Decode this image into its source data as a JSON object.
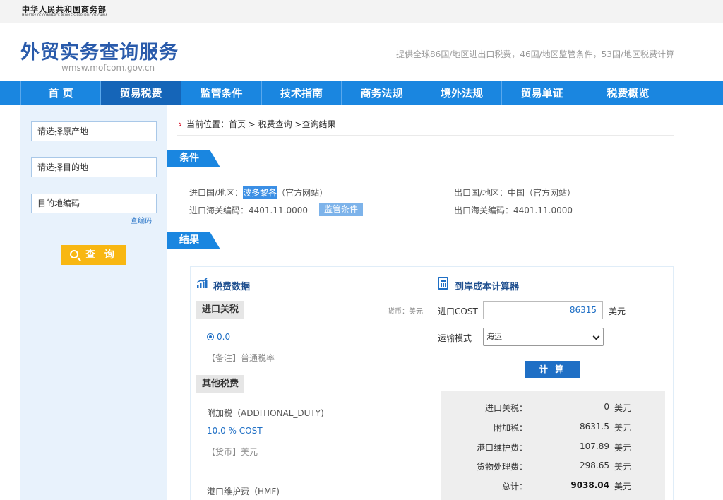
{
  "header": {
    "ministry_cn": "中华人民共和国商务部",
    "ministry_en": "MINISTRY OF COMMERCE PEOPLE'S REPUBLIC OF CHINA",
    "site_title": "外贸实务查询服务",
    "site_url": "wmsw.mofcom.gov.cn",
    "slogan": "提供全球86国/地区进出口税费，46国/地区监管条件，53国/地区税费计算"
  },
  "nav": [
    "首 页",
    "贸易税费",
    "监管条件",
    "技术指南",
    "商务法规",
    "境外法规",
    "贸易单证",
    "税费概览"
  ],
  "sidebar": {
    "origin_placeholder": "请选择原产地",
    "destination_placeholder": "请选择目的地",
    "dest_code_placeholder": "目的地编码",
    "code_link": "查编码",
    "query_button": "查 询"
  },
  "breadcrumb": "当前位置：首页 > 税费查询 >查询结果",
  "conditions": {
    "section_label": "条件",
    "import_country_label": "进口国/地区：",
    "import_country": "波多黎各",
    "import_site": "（官方网站）",
    "export_country_label": "出口国/地区：中国",
    "export_site": "（官方网站）",
    "import_code_label": "进口海关编码：4401.11.0000",
    "supervision_btn": "监管条件",
    "export_code_label": "出口海关编码：4401.11.0000"
  },
  "results": {
    "section_label": "结果",
    "tax_data_title": "税费数据",
    "import_duty_label": "进口关税",
    "currency_note": "货币：美元",
    "duty_rate": "0.0",
    "duty_remark": "【备注】普通税率",
    "other_taxes_label": "其他税费",
    "additional_duty_name": "附加税（ADDITIONAL_DUTY)",
    "additional_duty_rate": "10.0 % COST",
    "additional_duty_currency": "【货币】美元",
    "hmf_name": "港口维护费（HMF)"
  },
  "calculator": {
    "title": "到岸成本计算器",
    "cost_label": "进口COST",
    "cost_value": "86315",
    "cost_unit": "美元",
    "transport_label": "运输模式",
    "transport_selected": "海运",
    "calc_button": "计 算",
    "rows": [
      {
        "label": "进口关税：",
        "value": "0",
        "unit": "美元"
      },
      {
        "label": "附加税：",
        "value": "8631.5",
        "unit": "美元"
      },
      {
        "label": "港口维护费：",
        "value": "107.89",
        "unit": "美元"
      },
      {
        "label": "货物处理费：",
        "value": "298.65",
        "unit": "美元"
      },
      {
        "label": "总计：",
        "value": "9038.04",
        "unit": "美元"
      }
    ]
  },
  "colors": {
    "nav_blue": "#1a86e0",
    "nav_active": "#1565b8",
    "title_blue": "#2a5bab",
    "query_yellow": "#f8b712",
    "sidebar_bg": "#e8f2fc"
  }
}
